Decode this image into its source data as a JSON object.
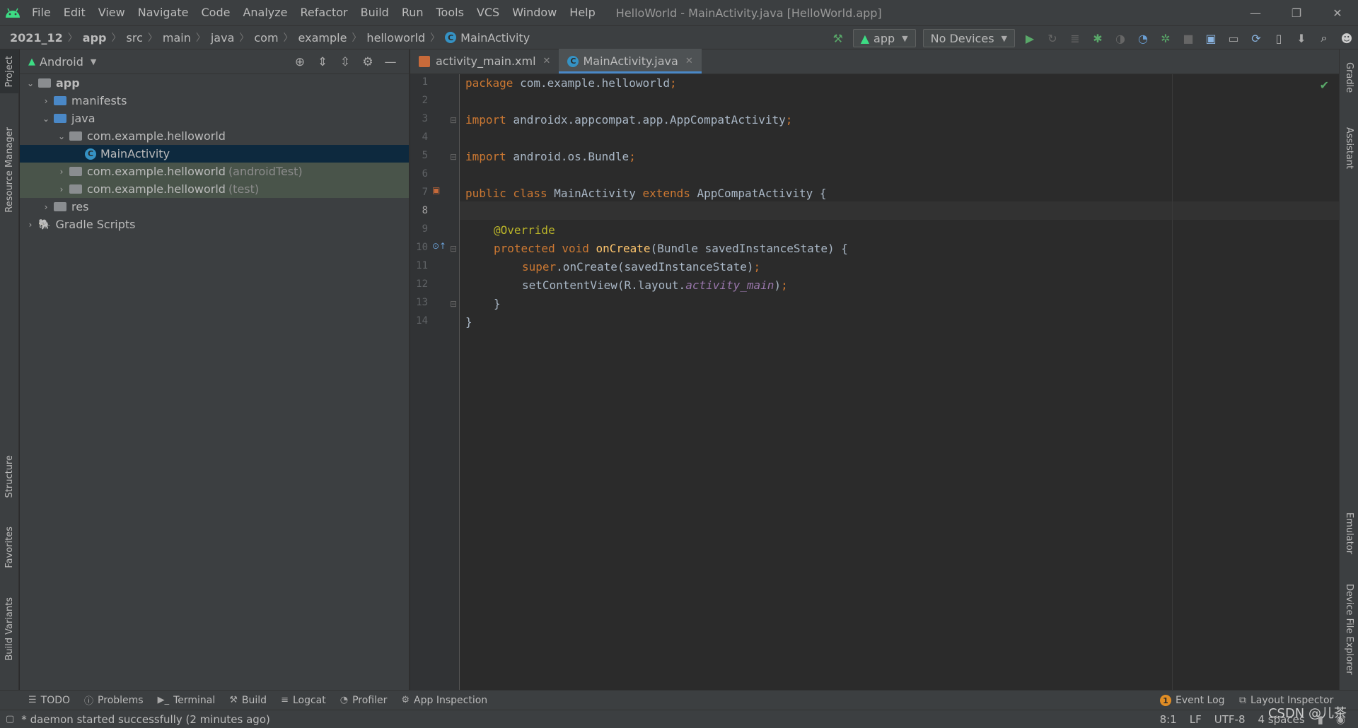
{
  "menubar": {
    "items": [
      "File",
      "Edit",
      "View",
      "Navigate",
      "Code",
      "Analyze",
      "Refactor",
      "Build",
      "Run",
      "Tools",
      "VCS",
      "Window",
      "Help"
    ],
    "title": "HelloWorld - MainActivity.java [HelloWorld.app]",
    "window_controls": [
      "—",
      "❐",
      "✕"
    ]
  },
  "navbar": {
    "breadcrumbs": [
      "2021_12",
      "app",
      "src",
      "main",
      "java",
      "com",
      "example",
      "helloworld",
      "MainActivity"
    ],
    "run_config": "app",
    "device": "No Devices"
  },
  "left_strip": {
    "tabs": [
      "Project",
      "Resource Manager",
      "Structure",
      "Favorites",
      "Build Variants"
    ]
  },
  "right_strip": {
    "tabs": [
      "Gradle",
      "Assistant",
      "Emulator",
      "Device File Explorer"
    ]
  },
  "project_panel": {
    "view": "Android",
    "tree": [
      {
        "label": "app",
        "suffix": ""
      },
      {
        "label": "manifests",
        "suffix": ""
      },
      {
        "label": "java",
        "suffix": ""
      },
      {
        "label": "com.example.helloworld",
        "suffix": ""
      },
      {
        "label": "MainActivity",
        "suffix": ""
      },
      {
        "label": "com.example.helloworld",
        "suffix": "(androidTest)"
      },
      {
        "label": "com.example.helloworld",
        "suffix": "(test)"
      },
      {
        "label": "res",
        "suffix": ""
      },
      {
        "label": "Gradle Scripts",
        "suffix": ""
      }
    ]
  },
  "editor": {
    "tabs": [
      {
        "label": "activity_main.xml",
        "active": false
      },
      {
        "label": "MainActivity.java",
        "active": true
      }
    ],
    "current_line": 8,
    "line_numbers": [
      "1",
      "2",
      "3",
      "4",
      "5",
      "6",
      "7",
      "8",
      "9",
      "10",
      "11",
      "12",
      "13",
      "14"
    ],
    "code": {
      "l1_kw": "package",
      "l1_rest": " com.example.helloworld",
      "l1_semi": ";",
      "l3_kw": "import",
      "l3_rest": " androidx.appcompat.app.AppCompatActivity",
      "l3_semi": ";",
      "l5_kw": "import",
      "l5_rest": " android.os.Bundle",
      "l5_semi": ";",
      "l7_kw1": "public class",
      "l7_name": " MainActivity ",
      "l7_kw2": "extends",
      "l7_rest": " AppCompatActivity {",
      "l9_ann": "@Override",
      "l10_kw": "protected void",
      "l10_fn": "onCreate",
      "l10_rest": "(Bundle savedInstanceState) {",
      "l11_kw": "super",
      "l11_rest": ".onCreate(savedInstanceState)",
      "l11_semi": ";",
      "l12_a": "setContentView(R.layout.",
      "l12_it": "activity_main",
      "l12_b": ")",
      "l12_semi": ";",
      "l13": "}",
      "l14": "}"
    }
  },
  "bottom_tools": {
    "left": [
      "TODO",
      "Problems",
      "Terminal",
      "Build",
      "Logcat",
      "Profiler",
      "App Inspection"
    ],
    "event_log": "Event Log",
    "event_count": "1",
    "layout_inspector": "Layout Inspector"
  },
  "status": {
    "message": "* daemon started successfully (2 minutes ago)",
    "position": "8:1",
    "line_sep": "LF",
    "encoding": "UTF-8",
    "indent": "4 spaces"
  },
  "watermark": "CSDN @儿茶",
  "colors": {
    "accent": "#4a88c7",
    "keyword": "#cc7832",
    "annotation": "#bbb529",
    "function": "#ffc66d",
    "field": "#9876aa",
    "run_green": "#59a869"
  }
}
